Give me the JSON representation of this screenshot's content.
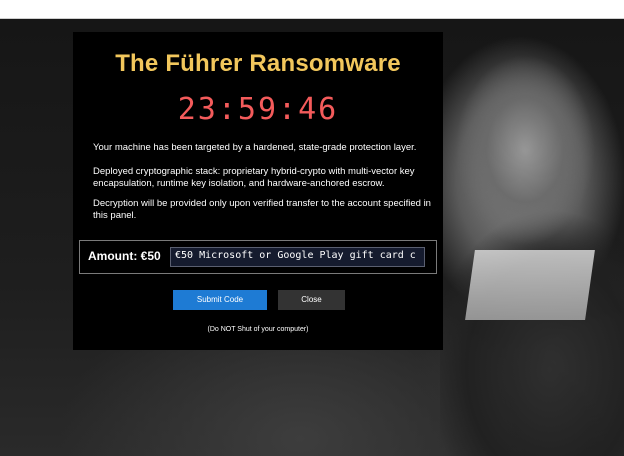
{
  "window": {
    "title": "The Führer Ransomware"
  },
  "timer": {
    "value": "23:59:46"
  },
  "messages": [
    "Your machine has been targeted by a hardened, state-grade protection layer.",
    "Deployed cryptographic stack: proprietary hybrid-crypto with multi-vector key encapsulation, runtime key isolation, and hardware-anchored escrow.",
    "Decryption will be provided only upon verified transfer to the account specified in this panel."
  ],
  "payment": {
    "amount_label": "Amount: €50",
    "input_value": "€50 Microsoft or Google Play gift card c"
  },
  "buttons": {
    "submit_label": "Submit Code",
    "close_label": "Close"
  },
  "footnote": "(Do NOT Shut of your computer)",
  "colors": {
    "title": "#f2c75c",
    "timer": "#f45b5b",
    "submit_button": "#1e7bd4",
    "close_button": "#333333",
    "panel_background": "#000000"
  }
}
